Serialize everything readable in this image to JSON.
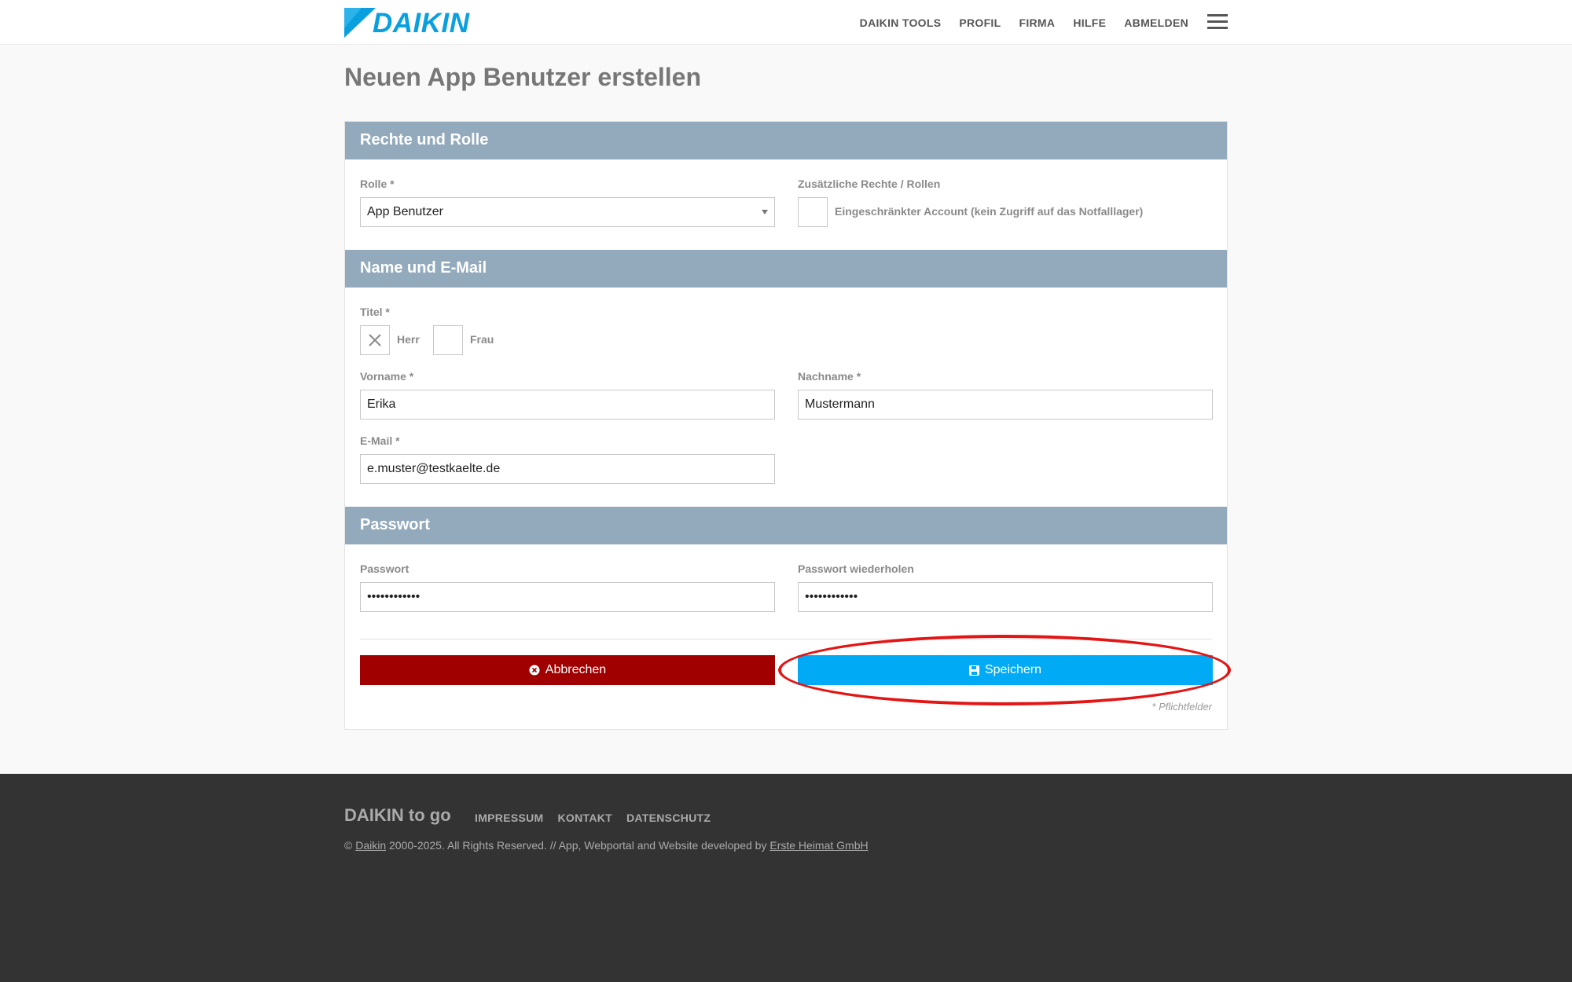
{
  "header": {
    "logo_text": "DAIKIN",
    "nav": [
      "DAIKIN TOOLS",
      "PROFIL",
      "FIRMA",
      "HILFE",
      "ABMELDEN"
    ]
  },
  "page_title": "Neuen App Benutzer erstellen",
  "sections": {
    "rights": {
      "title": "Rechte und Rolle",
      "role_label": "Rolle *",
      "role_value": "App Benutzer",
      "extra_label": "Zusätzliche Rechte / Rollen",
      "extra_option": "Eingeschränkter Account (kein Zugriff auf das Notfalllager)",
      "extra_checked": false
    },
    "name": {
      "title": "Name und E-Mail",
      "title_label": "Titel *",
      "options": [
        {
          "label": "Herr",
          "checked": true
        },
        {
          "label": "Frau",
          "checked": false
        }
      ],
      "firstname_label": "Vorname *",
      "firstname_value": "Erika",
      "lastname_label": "Nachname *",
      "lastname_value": "Mustermann",
      "email_label": "E-Mail *",
      "email_value": "e.muster@testkaelte.de"
    },
    "password": {
      "title": "Passwort",
      "password_label": "Passwort",
      "password_value": "••••••••••••",
      "repeat_label": "Passwort wiederholen",
      "repeat_value": "••••••••••••"
    }
  },
  "actions": {
    "cancel_label": "Abbrechen",
    "save_label": "Speichern",
    "required_note": "* Pflichtfelder"
  },
  "colors": {
    "brand": "#0aa0e0",
    "section_header": "#93aabd",
    "cancel": "#a00000",
    "save": "#00aaf5",
    "highlight": "#e31515",
    "footer": "#333333"
  },
  "footer": {
    "brand": "DAIKIN to go",
    "links": [
      "IMPRESSUM",
      "KONTAKT",
      "DATENSCHUTZ"
    ],
    "copy_prefix": "©",
    "copy_link1": "Daikin",
    "copy_middle": "2000-2025. All Rights Reserved. // App, Webportal and Website developed by",
    "copy_link2": "Erste Heimat GmbH"
  }
}
